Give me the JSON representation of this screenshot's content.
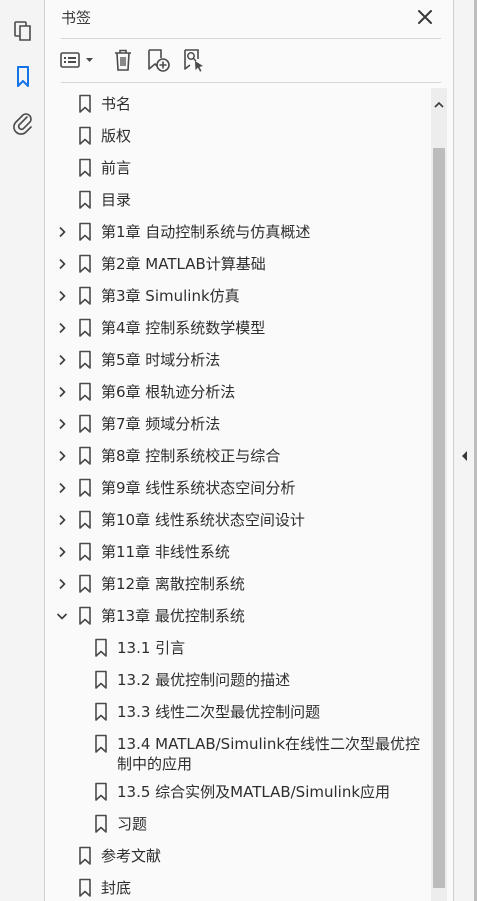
{
  "panel": {
    "title": "书签"
  },
  "left_rail": {
    "icons": [
      "pages-icon",
      "bookmark-icon",
      "attachment-icon"
    ]
  },
  "toolbar": {
    "buttons": [
      "options-menu-icon",
      "delete-bookmark-icon",
      "new-bookmark-icon",
      "find-bookmark-icon"
    ]
  },
  "bookmarks": [
    {
      "label": "书名",
      "level": 0,
      "expander": "none"
    },
    {
      "label": "版权",
      "level": 0,
      "expander": "none"
    },
    {
      "label": "前言",
      "level": 0,
      "expander": "none"
    },
    {
      "label": "目录",
      "level": 0,
      "expander": "none"
    },
    {
      "label": "第1章 自动控制系统与仿真概述",
      "level": 0,
      "expander": "collapsed"
    },
    {
      "label": "第2章 MATLAB计算基础",
      "level": 0,
      "expander": "collapsed"
    },
    {
      "label": "第3章 Simulink仿真",
      "level": 0,
      "expander": "collapsed"
    },
    {
      "label": "第4章 控制系统数学模型",
      "level": 0,
      "expander": "collapsed"
    },
    {
      "label": "第5章 时域分析法",
      "level": 0,
      "expander": "collapsed"
    },
    {
      "label": "第6章 根轨迹分析法",
      "level": 0,
      "expander": "collapsed"
    },
    {
      "label": "第7章 频域分析法",
      "level": 0,
      "expander": "collapsed"
    },
    {
      "label": "第8章 控制系统校正与综合",
      "level": 0,
      "expander": "collapsed"
    },
    {
      "label": "第9章 线性系统状态空间分析",
      "level": 0,
      "expander": "collapsed"
    },
    {
      "label": "第10章 线性系统状态空间设计",
      "level": 0,
      "expander": "collapsed"
    },
    {
      "label": "第11章 非线性系统",
      "level": 0,
      "expander": "collapsed"
    },
    {
      "label": "第12章 离散控制系统",
      "level": 0,
      "expander": "collapsed"
    },
    {
      "label": "第13章 最优控制系统",
      "level": 0,
      "expander": "expanded"
    },
    {
      "label": "13.1 引言",
      "level": 1,
      "expander": "none"
    },
    {
      "label": "13.2 最优控制问题的描述",
      "level": 1,
      "expander": "none"
    },
    {
      "label": "13.3 线性二次型最优控制问题",
      "level": 1,
      "expander": "none"
    },
    {
      "label": "13.4 MATLAB/Simulink在线性二次型最优控制中的应用",
      "level": 1,
      "expander": "none"
    },
    {
      "label": "13.5 综合实例及MATLAB/Simulink应用",
      "level": 1,
      "expander": "none"
    },
    {
      "label": "习题",
      "level": 1,
      "expander": "none"
    },
    {
      "label": "参考文献",
      "level": 0,
      "expander": "none"
    },
    {
      "label": "封底",
      "level": 0,
      "expander": "none"
    }
  ],
  "colors": {
    "accent": "#1473e6",
    "icon": "#4b4b4b",
    "panel_bg": "#fafafa"
  }
}
